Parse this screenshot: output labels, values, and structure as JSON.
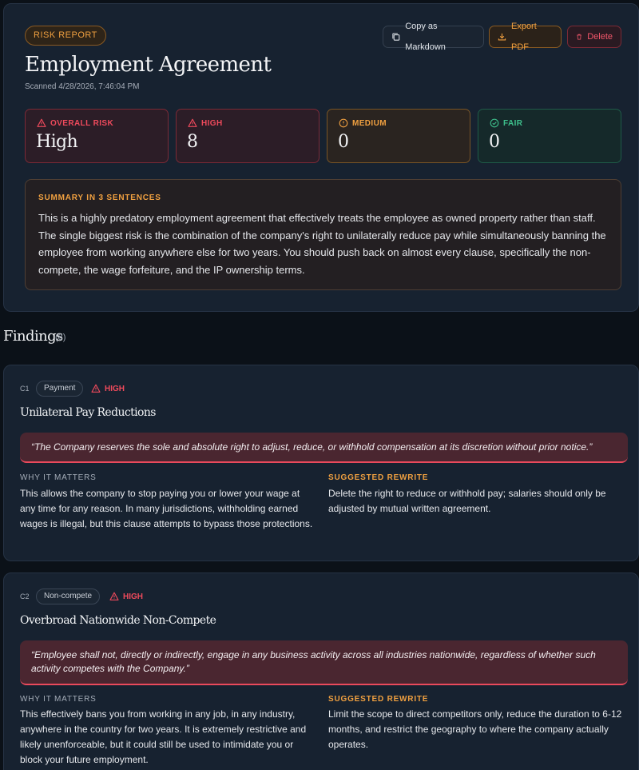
{
  "report": {
    "badge": "RISK REPORT",
    "title": "Employment Agreement",
    "scanned": "Scanned 4/28/2026, 7:46:04 PM",
    "actions": {
      "copy": "Copy as Markdown",
      "pdf": "Export PDF",
      "delete": "Delete"
    },
    "stats": [
      {
        "label": "OVERALL RISK",
        "value": "High"
      },
      {
        "label": "HIGH",
        "value": "8"
      },
      {
        "label": "MEDIUM",
        "value": "0"
      },
      {
        "label": "FAIR",
        "value": "0"
      }
    ],
    "summary": {
      "heading": "SUMMARY IN 3 SENTENCES",
      "text": "This is a highly predatory employment agreement that effectively treats the employee as owned property rather than staff. The single biggest risk is the combination of the company's right to unilaterally reduce pay while simultaneously banning the employee from working anywhere else for two years. You should push back on almost every clause, specifically the non-compete, the wage forfeiture, and the IP ownership terms."
    }
  },
  "findings": {
    "title": "Findings",
    "count": "(8)",
    "items": [
      {
        "id": "C1",
        "tag": "Payment",
        "severity": "HIGH",
        "title": "Unilateral Pay Reductions",
        "quote": "“The Company reserves the sole and absolute right to adjust, reduce, or withhold compensation at its discretion without prior notice.”",
        "why_heading": "WHY IT MATTERS",
        "why": "This allows the company to stop paying you or lower your wage at any time for any reason. In many jurisdictions, withholding earned wages is illegal, but this clause attempts to bypass those protections.",
        "rewrite_heading": "SUGGESTED REWRITE",
        "rewrite": "Delete the right to reduce or withhold pay; salaries should only be adjusted by mutual written agreement."
      },
      {
        "id": "C2",
        "tag": "Non-compete",
        "severity": "HIGH",
        "title": "Overbroad Nationwide Non-Compete",
        "quote": "“Employee shall not, directly or indirectly, engage in any business activity across all industries nationwide, regardless of whether such activity competes with the Company.”",
        "why_heading": "WHY IT MATTERS",
        "why": "This effectively bans you from working in any job, in any industry, anywhere in the country for two years. It is extremely restrictive and likely unenforceable, but it could still be used to intimidate you or block your future employment.",
        "rewrite_heading": "SUGGESTED REWRITE",
        "rewrite": "Limit the scope to direct competitors only, reduce the duration to 6-12 months, and restrict the geography to where the company actually operates."
      }
    ]
  },
  "colors": {
    "background": "#0b1118",
    "card": "#172230",
    "high": "#ef4a5c",
    "medium": "#f0a040",
    "fair": "#3ec08c"
  }
}
